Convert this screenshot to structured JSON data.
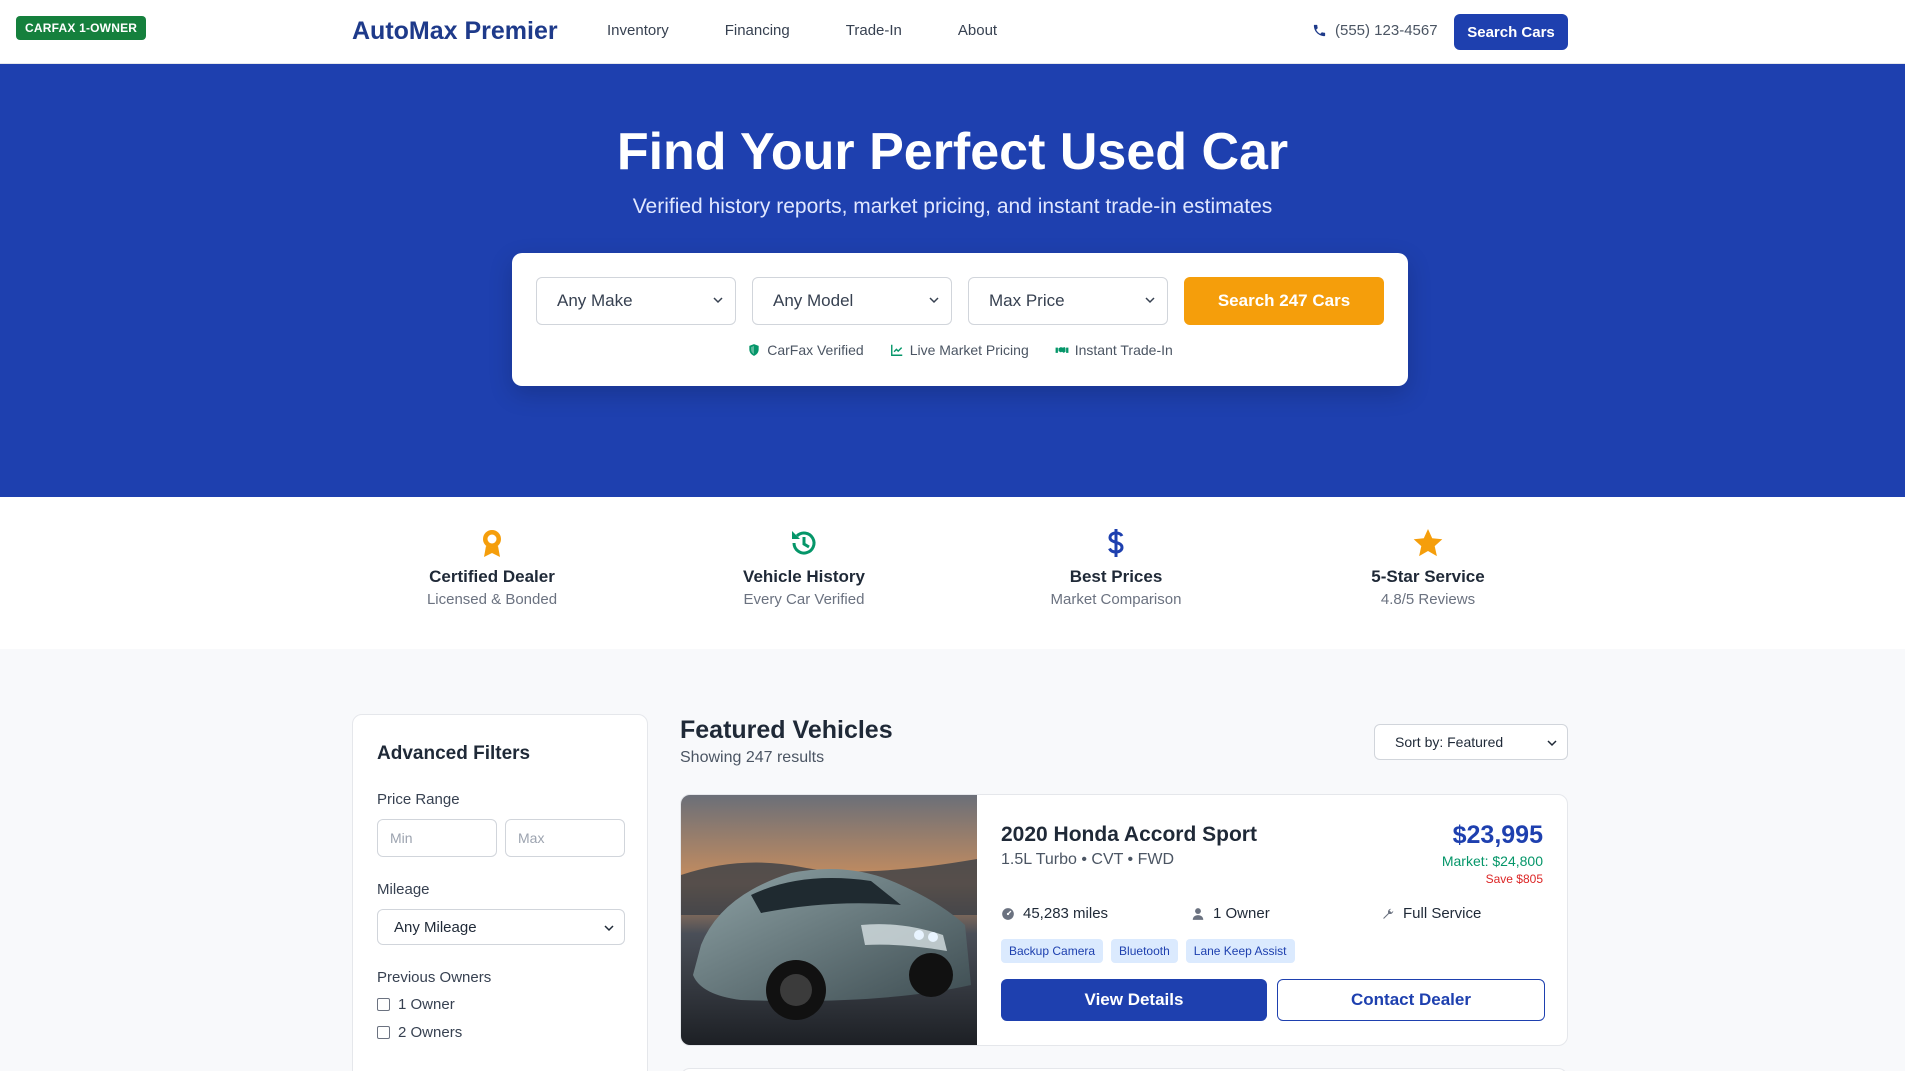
{
  "header": {
    "badge": "CARFAX 1-OWNER",
    "brand": "AutoMax Premier",
    "nav": [
      "Inventory",
      "Financing",
      "Trade-In",
      "About"
    ],
    "phone": "(555) 123-4567",
    "search_button": "Search Cars"
  },
  "hero": {
    "title": "Find Your Perfect Used Car",
    "subtitle": "Verified history reports, market pricing, and instant trade-in estimates",
    "make_select": "Any Make",
    "model_select": "Any Model",
    "price_select": "Max Price",
    "search_button": "Search 247 Cars",
    "features": [
      "CarFax Verified",
      "Live Market Pricing",
      "Instant Trade-In"
    ]
  },
  "trust": [
    {
      "title": "Certified Dealer",
      "subtitle": "Licensed & Bonded",
      "icon": "award-icon",
      "color": "#f59e0b"
    },
    {
      "title": "Vehicle History",
      "subtitle": "Every Car Verified",
      "icon": "history-icon",
      "color": "#059669"
    },
    {
      "title": "Best Prices",
      "subtitle": "Market Comparison",
      "icon": "dollar-icon",
      "color": "#1e40af"
    },
    {
      "title": "5-Star Service",
      "subtitle": "4.8/5 Reviews",
      "icon": "star-icon",
      "color": "#f59e0b"
    }
  ],
  "filters": {
    "title": "Advanced Filters",
    "price_label": "Price Range",
    "min_placeholder": "Min",
    "max_placeholder": "Max",
    "mileage_label": "Mileage",
    "mileage_value": "Any Mileage",
    "owners_label": "Previous Owners",
    "owners": [
      "1 Owner",
      "2 Owners"
    ]
  },
  "listings": {
    "title": "Featured Vehicles",
    "count": "Showing 247 results",
    "sort": "Sort by: Featured",
    "cards": [
      {
        "title": "2020 Honda Accord Sport",
        "spec": "1.5L Turbo • CVT • FWD",
        "price": "$23,995",
        "market": "Market: $24,800",
        "save": "Save $805",
        "miles": "45,283 miles",
        "owners": "1 Owner",
        "service": "Full Service",
        "tags": [
          "Backup Camera",
          "Bluetooth",
          "Lane Keep Assist"
        ],
        "view_button": "View Details",
        "contact_button": "Contact Dealer"
      }
    ]
  },
  "colors": {
    "primary": "#1e40af",
    "accent": "#f59e0b",
    "success": "#059669",
    "danger": "#dc2626"
  }
}
